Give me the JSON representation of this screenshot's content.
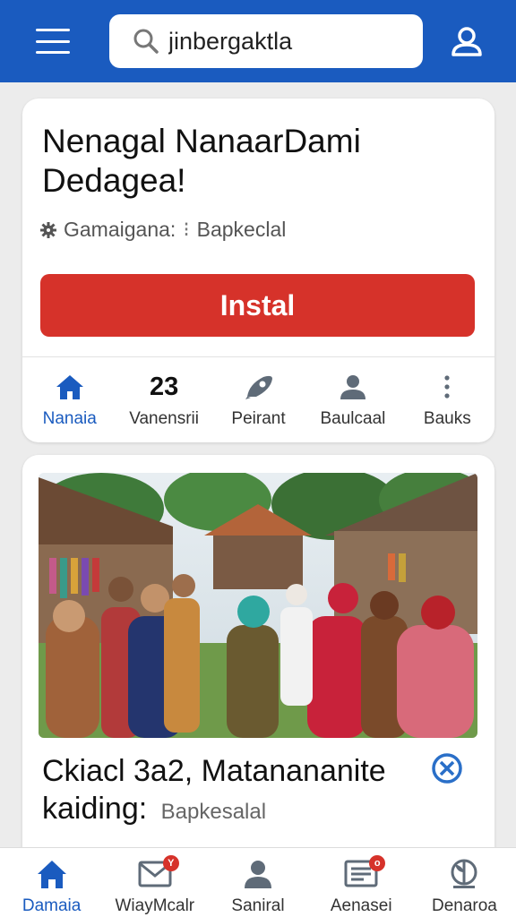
{
  "header": {
    "search_value": "jinbergaktla",
    "menu_icon": "hamburger-icon",
    "profile_icon": "user-icon",
    "bar_color": "#1a5bbf"
  },
  "app_card": {
    "title": "Nenagal NanaarDami Dedagea!",
    "meta_label": "Gamaigana:",
    "meta_value": "Bapkeclal",
    "install_label": "Instal",
    "install_color": "#d6322a",
    "stats": [
      {
        "icon": "home-icon",
        "value": "",
        "label": "Nanaia"
      },
      {
        "icon": "",
        "value": "23",
        "label": "Vanensrii"
      },
      {
        "icon": "rocket-icon",
        "value": "",
        "label": "Peirant"
      },
      {
        "icon": "user-icon",
        "value": "",
        "label": "Baulcaal"
      },
      {
        "icon": "more-icon",
        "value": "",
        "label": "Bauks"
      }
    ]
  },
  "post_card": {
    "photo_icon": "community-gathering-photo",
    "title": "Ckiacl 3a2, Matanananite kaiding:",
    "subtitle": "Bapkesalal",
    "verified_icon": "verified-icon"
  },
  "bottom_nav": {
    "items": [
      {
        "icon": "home-icon",
        "label": "Damaia"
      },
      {
        "icon": "mail-icon",
        "label": "WiayMcalr",
        "badge": "Y"
      },
      {
        "icon": "user-icon",
        "label": "Saniral"
      },
      {
        "icon": "news-icon",
        "label": "Aenasei",
        "badge": "o"
      },
      {
        "icon": "globe-icon",
        "label": "Denaroa"
      }
    ]
  }
}
